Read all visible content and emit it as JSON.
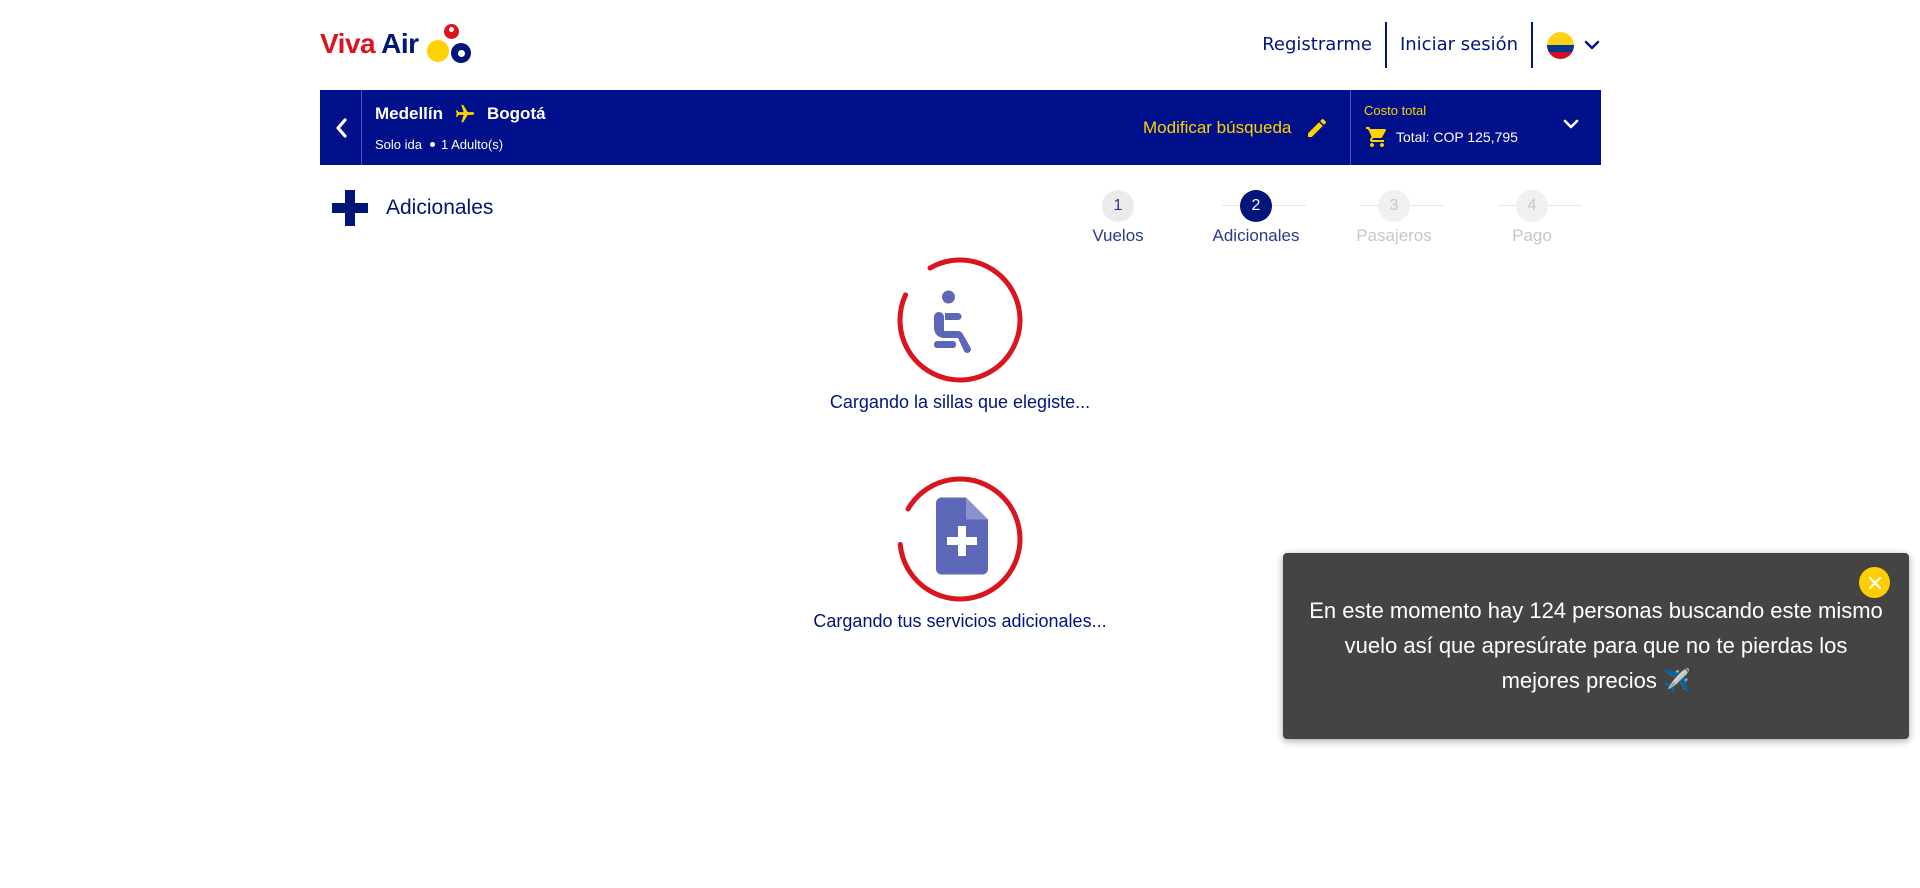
{
  "brand": {
    "name_part1": "Viva",
    "name_part2": "Air",
    "colors": {
      "red": "#d9161f",
      "blue": "#00157a",
      "yellow": "#ffd200"
    }
  },
  "header": {
    "register_label": "Registrarme",
    "login_label": "Iniciar sesión",
    "language_icon": "colombia-flag-icon",
    "language_dropdown_icon": "chevron-down-icon"
  },
  "search_bar": {
    "back_icon": "chevron-left-icon",
    "origin": "Medellín",
    "destination": "Bogotá",
    "route_icon": "plane-icon",
    "trip_type": "Solo ida",
    "passengers": "1 Adulto(s)",
    "modify_label": "Modificar búsqueda",
    "modify_icon": "pencil-icon",
    "total_label": "Costo total",
    "total_value": "Total: COP 125,795",
    "cart_icon": "cart-icon",
    "expand_icon": "chevron-down-icon"
  },
  "section": {
    "title": "Adicionales",
    "icon": "plus-icon"
  },
  "stepper": {
    "steps": [
      {
        "number": "1",
        "label": "Vuelos",
        "state": "done"
      },
      {
        "number": "2",
        "label": "Adicionales",
        "state": "active"
      },
      {
        "number": "3",
        "label": "Pasajeros",
        "state": "todo"
      },
      {
        "number": "4",
        "label": "Pago",
        "state": "todo"
      }
    ]
  },
  "loaders": [
    {
      "icon": "seat-icon",
      "text": "Cargando la sillas que elegiste..."
    },
    {
      "icon": "document-plus-icon",
      "text": "Cargando tus servicios adicionales..."
    }
  ],
  "toast": {
    "message": "En este momento hay 124 personas buscando este mismo vuelo así que apresúrate para que no te pierdas los mejores precios ✈️",
    "close_icon": "close-icon"
  }
}
